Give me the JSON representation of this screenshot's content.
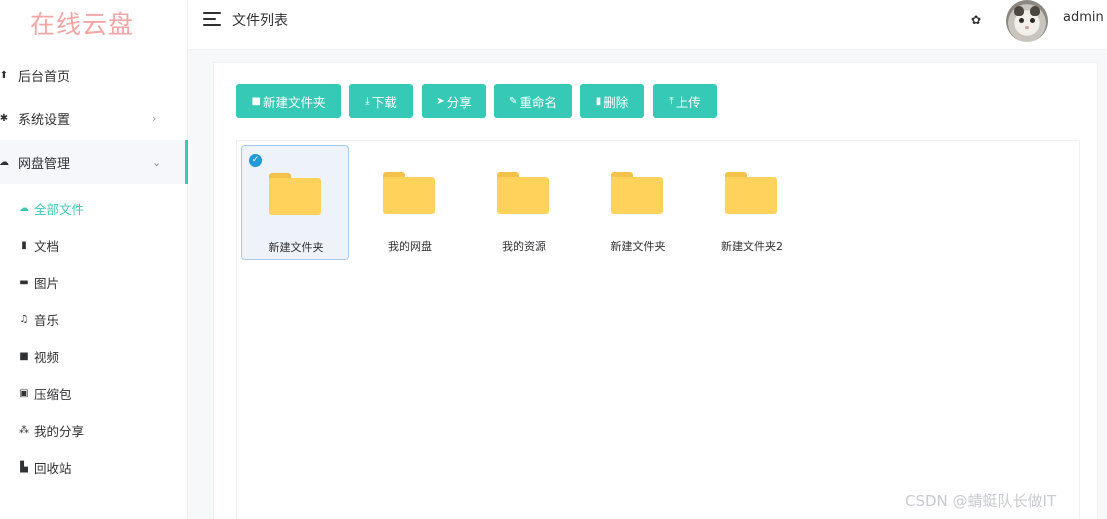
{
  "app": {
    "logo_text": "在线云盘"
  },
  "header": {
    "title": "文件列表",
    "username": "admin"
  },
  "sidebar": {
    "menu": [
      {
        "label": "后台首页",
        "icon": "home-icon"
      },
      {
        "label": "系统设置",
        "icon": "gear-icon",
        "arrow": "›"
      },
      {
        "label": "网盘管理",
        "icon": "cloud-icon",
        "arrow": "⌄"
      }
    ],
    "sub_items": [
      {
        "label": "全部文件",
        "icon": "cloud-icon",
        "active": true
      },
      {
        "label": "文档",
        "icon": "document-icon"
      },
      {
        "label": "图片",
        "icon": "image-icon"
      },
      {
        "label": "音乐",
        "icon": "music-icon"
      },
      {
        "label": "视频",
        "icon": "video-icon"
      },
      {
        "label": "压缩包",
        "icon": "archive-icon"
      },
      {
        "label": "我的分享",
        "icon": "share-icon"
      },
      {
        "label": "回收站",
        "icon": "trash-icon"
      }
    ]
  },
  "toolbar": {
    "new_folder": "新建文件夹",
    "download": "下载",
    "share": "分享",
    "rename": "重命名",
    "delete": "删除",
    "upload": "上传"
  },
  "files": [
    {
      "name": "新建文件夹",
      "selected": true
    },
    {
      "name": "我的网盘",
      "selected": false
    },
    {
      "name": "我的资源",
      "selected": false
    },
    {
      "name": "新建文件夹",
      "selected": false
    },
    {
      "name": "新建文件夹2",
      "selected": false
    }
  ],
  "watermark": "CSDN @蜻蜓队长做IT",
  "colors": {
    "accent": "#36c9b6",
    "folder": "#ffd25c",
    "logo": "#f2a6a6"
  }
}
